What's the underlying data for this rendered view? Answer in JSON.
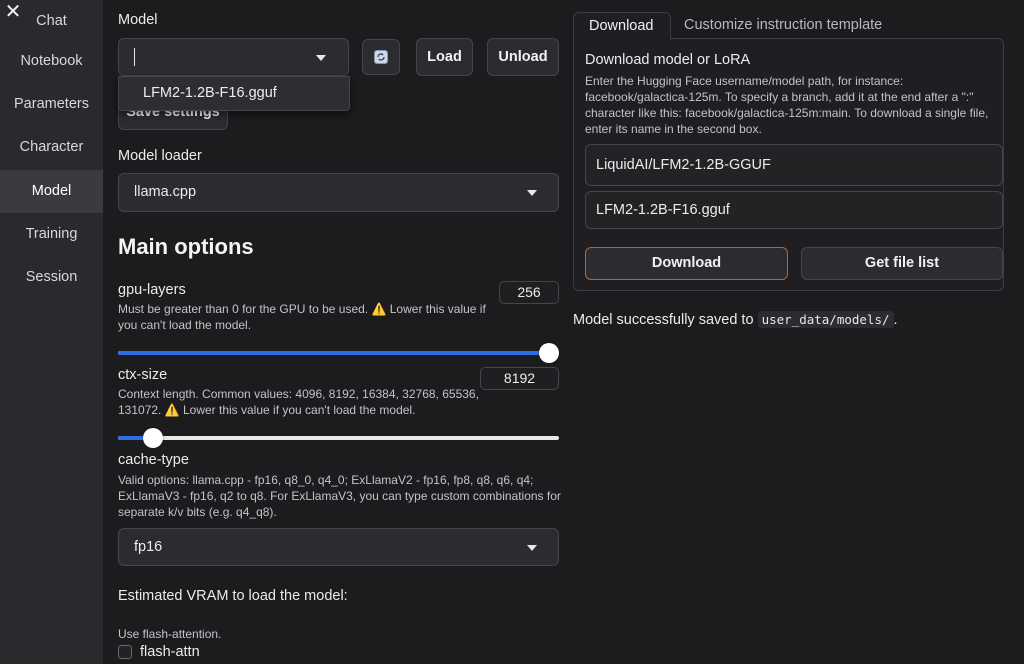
{
  "sidebar": {
    "close_glyph": "✕",
    "items": [
      "Chat",
      "Notebook",
      "Parameters",
      "Character",
      "Model",
      "Training",
      "Session"
    ],
    "active": "Model"
  },
  "model": {
    "label": "Model",
    "dropdown_value": "",
    "open_option": "LFM2-1.2B-F16.gguf",
    "refresh_glyph": "🔄",
    "load_label": "Load",
    "unload_label": "Unload",
    "save_settings_label": "Save settings"
  },
  "loader": {
    "label": "Model loader",
    "value": "llama.cpp"
  },
  "main_options": {
    "heading": "Main options",
    "gpu_layers": {
      "label": "gpu-layers",
      "help": "Must be greater than 0 for the GPU to be used. ⚠️ Lower this value if you can't load the model.",
      "value": "256",
      "fraction": 1.0
    },
    "ctx_size": {
      "label": "ctx-size",
      "help": "Context length. Common values: 4096, 8192, 16384, 32768, 65536, 131072. ⚠️ Lower this value if you can't load the model.",
      "value": "8192",
      "fraction": 0.08
    },
    "cache_type": {
      "label": "cache-type",
      "help": "Valid options: llama.cpp - fp16, q8_0, q4_0; ExLlamaV2 - fp16, fp8, q8, q6, q4; ExLlamaV3 - fp16, q2 to q8. For ExLlamaV3, you can type custom combinations for separate k/v bits (e.g. q4_q8).",
      "value": "fp16"
    },
    "vram_label": "Estimated VRAM to load the model:",
    "flash_help": "Use flash-attention.",
    "flash_label": "flash-attn"
  },
  "download_panel": {
    "tabs": [
      "Download",
      "Customize instruction template"
    ],
    "active_tab": "Download",
    "title": "Download model or LoRA",
    "description": "Enter the Hugging Face username/model path, for instance: facebook/galactica-125m. To specify a branch, add it at the end after a \":\" character like this: facebook/galactica-125m:main. To download a single file, enter its name in the second box.",
    "repo_value": "LiquidAI/LFM2-1.2B-GGUF",
    "file_value": "LFM2-1.2B-F16.gguf",
    "download_label": "Download",
    "file_list_label": "Get file list"
  },
  "status": {
    "prefix": "Model successfully saved to ",
    "path": "user_data/models/",
    "suffix": "."
  },
  "colors": {
    "accent_blue": "#2f6ee6",
    "download_border": "#c0622a"
  }
}
